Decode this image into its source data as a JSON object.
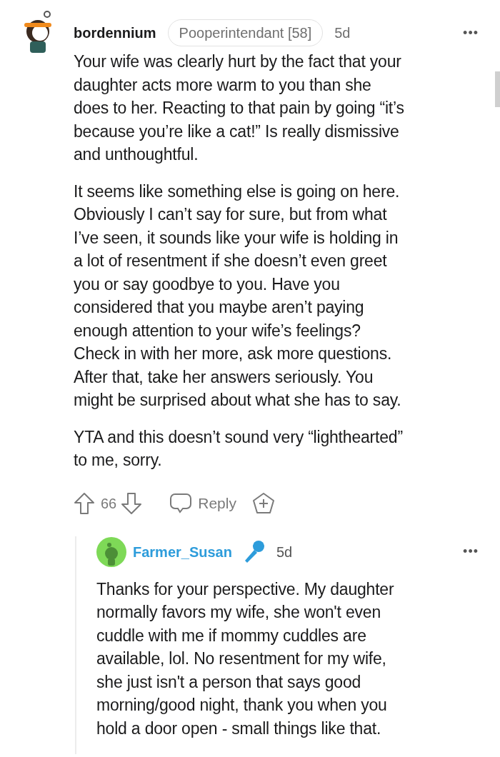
{
  "comment": {
    "author": "bordennium",
    "flair": "Pooperintendant [58]",
    "age": "5d",
    "menu": "•••",
    "paragraphs": [
      [
        "Your wife was clearly hurt by the fact that your",
        "daughter acts more warm to you than she",
        "does to her. Reacting to that pain by going “it’s",
        "because you’re like a cat!” Is really dismissive",
        "and unthoughtful."
      ],
      [
        "It seems like something else is going on here.",
        "Obviously I can’t say for sure, but from what",
        "I’ve seen, it sounds like your wife is holding in",
        "a lot of resentment if she doesn’t even greet",
        "you or say goodbye to you. Have you",
        "considered that you maybe aren’t paying",
        "enough attention to your wife’s feelings?",
        "Check in with her more, ask more questions.",
        "After that, take her answers seriously. You",
        "might be surprised about what she has to say."
      ],
      [
        "YTA and this doesn’t sound very “lighthearted”",
        "to me, sorry."
      ]
    ],
    "score": "66",
    "reply_label": "Reply"
  },
  "reply": {
    "author": "Farmer_Susan",
    "age": "5d",
    "menu": "•••",
    "paragraphs": [
      [
        "Thanks for your perspective. My daughter",
        "normally favors my wife, she won't even",
        "cuddle with me if mommy cuddles are",
        "available, lol. No resentment for my wife,",
        "she just isn't a person that says good",
        "morning/good night, thank you when you",
        "hold a door open - small things like that."
      ]
    ]
  }
}
